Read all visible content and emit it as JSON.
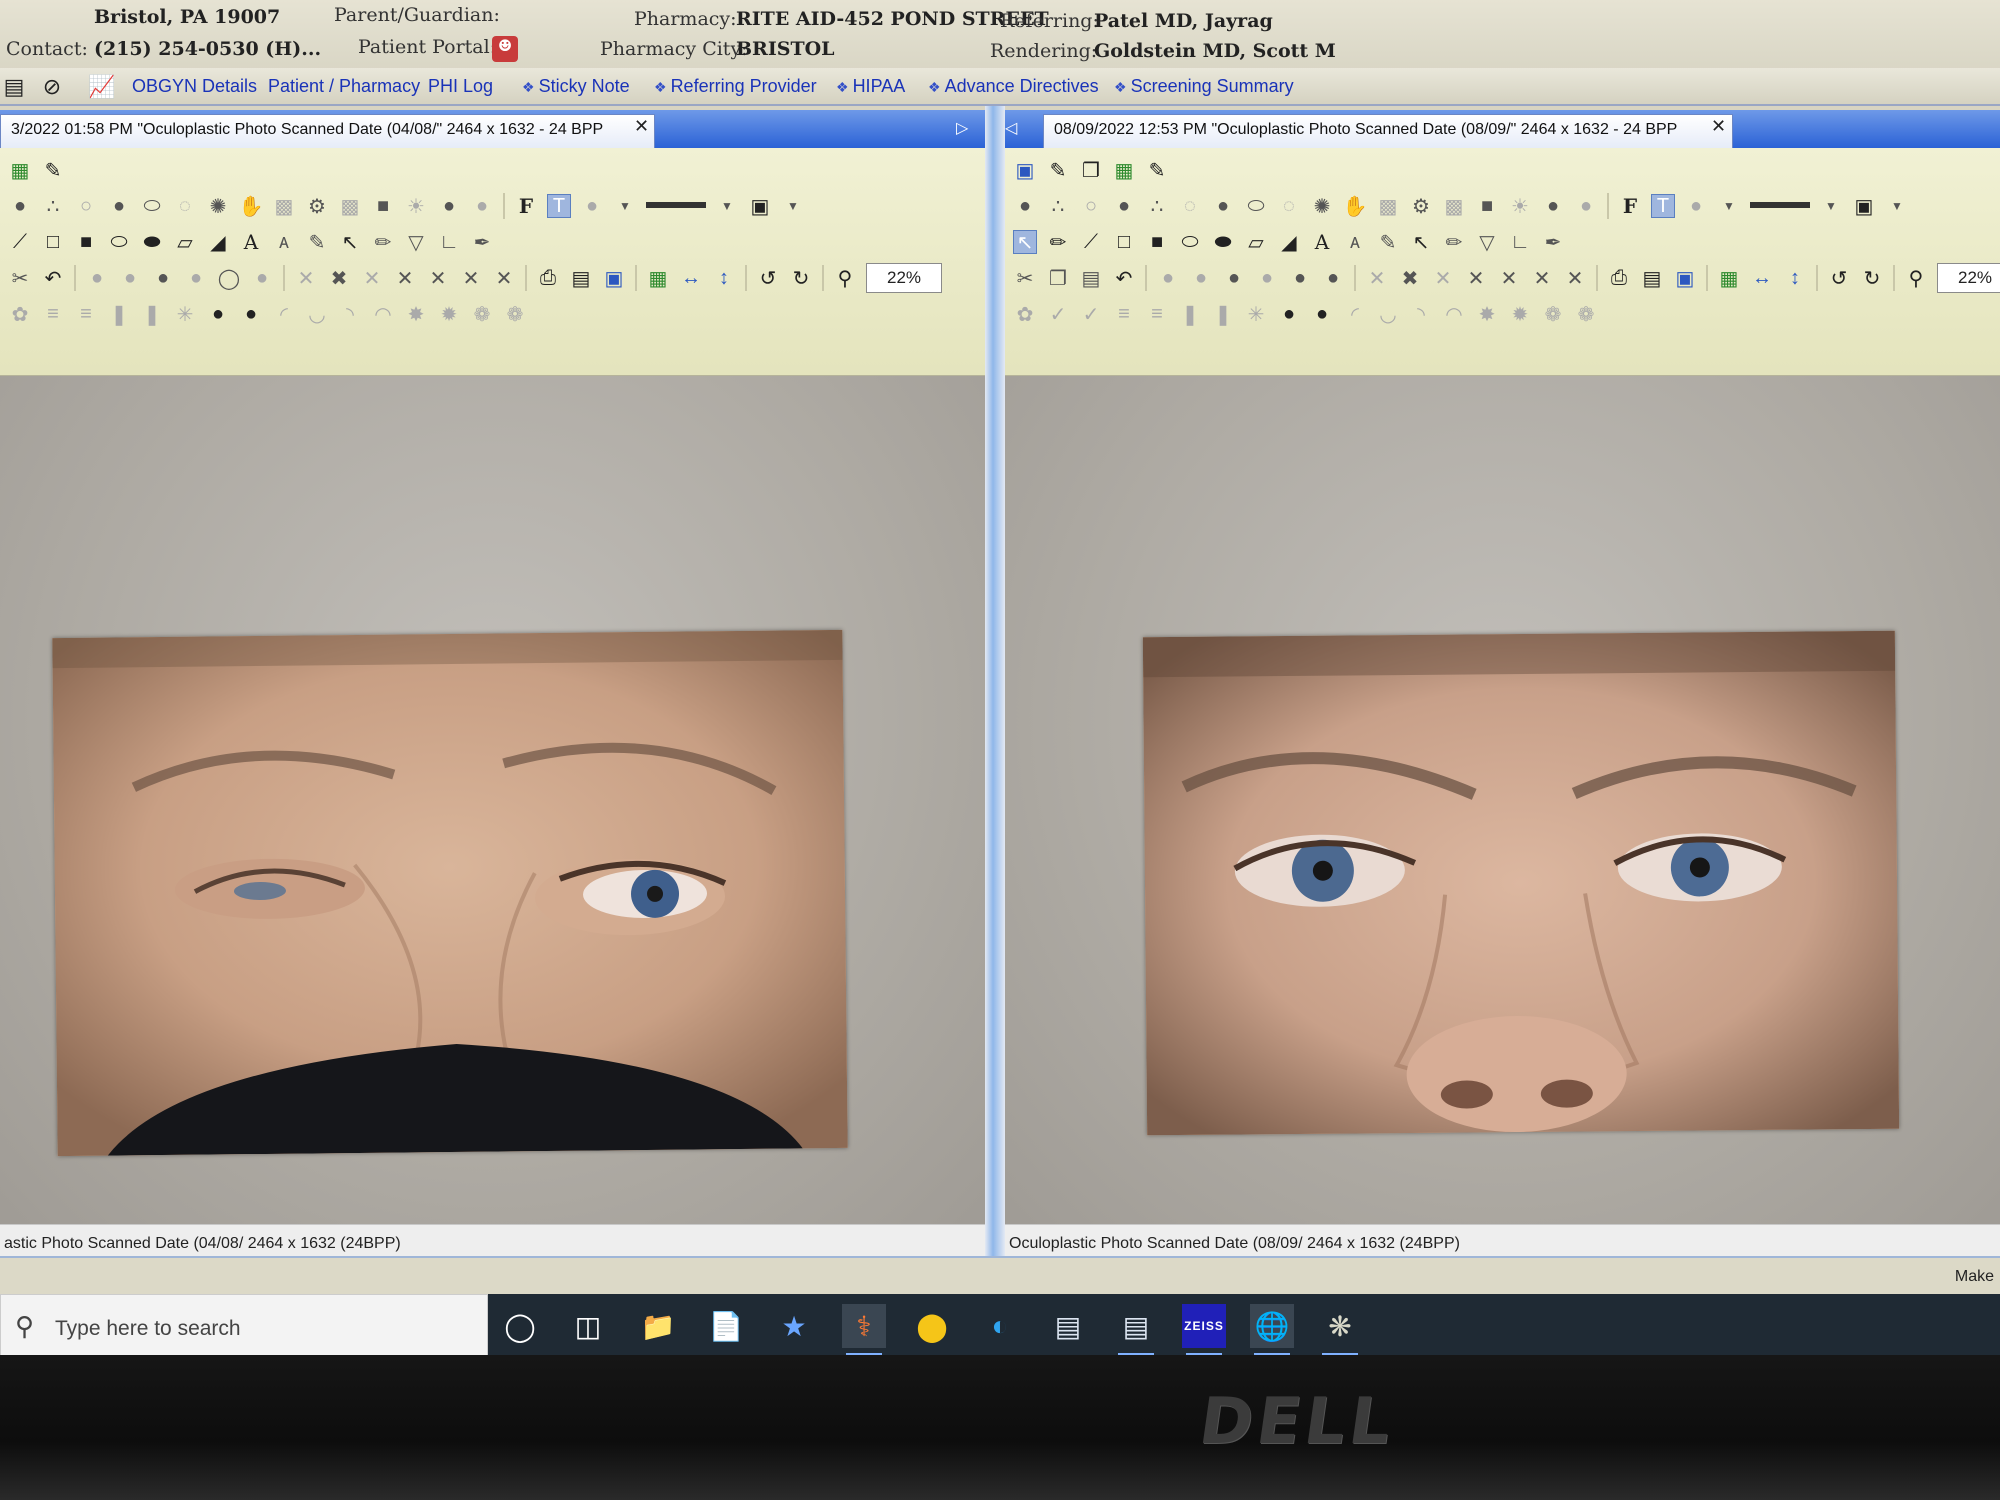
{
  "header": {
    "address": "Bristol, PA 19007",
    "contact_label": "Contact:",
    "contact_value": "(215) 254-0530 (H)...",
    "guardian_label": "Parent/Guardian:",
    "portal_label": "Patient Portal:",
    "pharmacy_label": "Pharmacy:",
    "pharmacy_value": "RITE AID-452 POND STREET",
    "pharmacy_city_label": "Pharmacy City:",
    "pharmacy_city_value": "BRISTOL",
    "referring_label": "Referring:",
    "referring_value": "Patel MD, Jayrag",
    "rendering_label": "Rendering:",
    "rendering_value": "Goldstein MD, Scott M"
  },
  "nav": {
    "links": [
      "OBGYN Details",
      "Patient / Pharmacy",
      "PHI Log",
      "Sticky Note",
      "Referring Provider",
      "HIPAA",
      "Advance Directives",
      "Screening Summary"
    ]
  },
  "left_pane": {
    "tab_title": "3/2022 01:58 PM \"Oculoplastic Photo  Scanned Date (04/08/\" 2464 x 1632 - 24 BPP",
    "zoom": "22%",
    "status": "astic Photo  Scanned Date (04/08/  2464 x 1632 (24BPP)"
  },
  "right_pane": {
    "tab_title": "08/09/2022 12:53 PM \"Oculoplastic Photo  Scanned Date (08/09/\" 2464 x 1632 - 24 BPP",
    "zoom": "22%",
    "status": "Oculoplastic Photo  Scanned Date (08/09/  2464 x 1632 (24BPP)"
  },
  "footer": {
    "make_label": "Make"
  },
  "taskbar": {
    "search_placeholder": "Type here to search",
    "zeiss_label": "ZEISS"
  },
  "monitor": {
    "brand": "DELL"
  },
  "colors": {
    "accent": "#2b62d6",
    "nav_link": "#1a33b8",
    "toolbar_bg": "#eeeecb"
  }
}
